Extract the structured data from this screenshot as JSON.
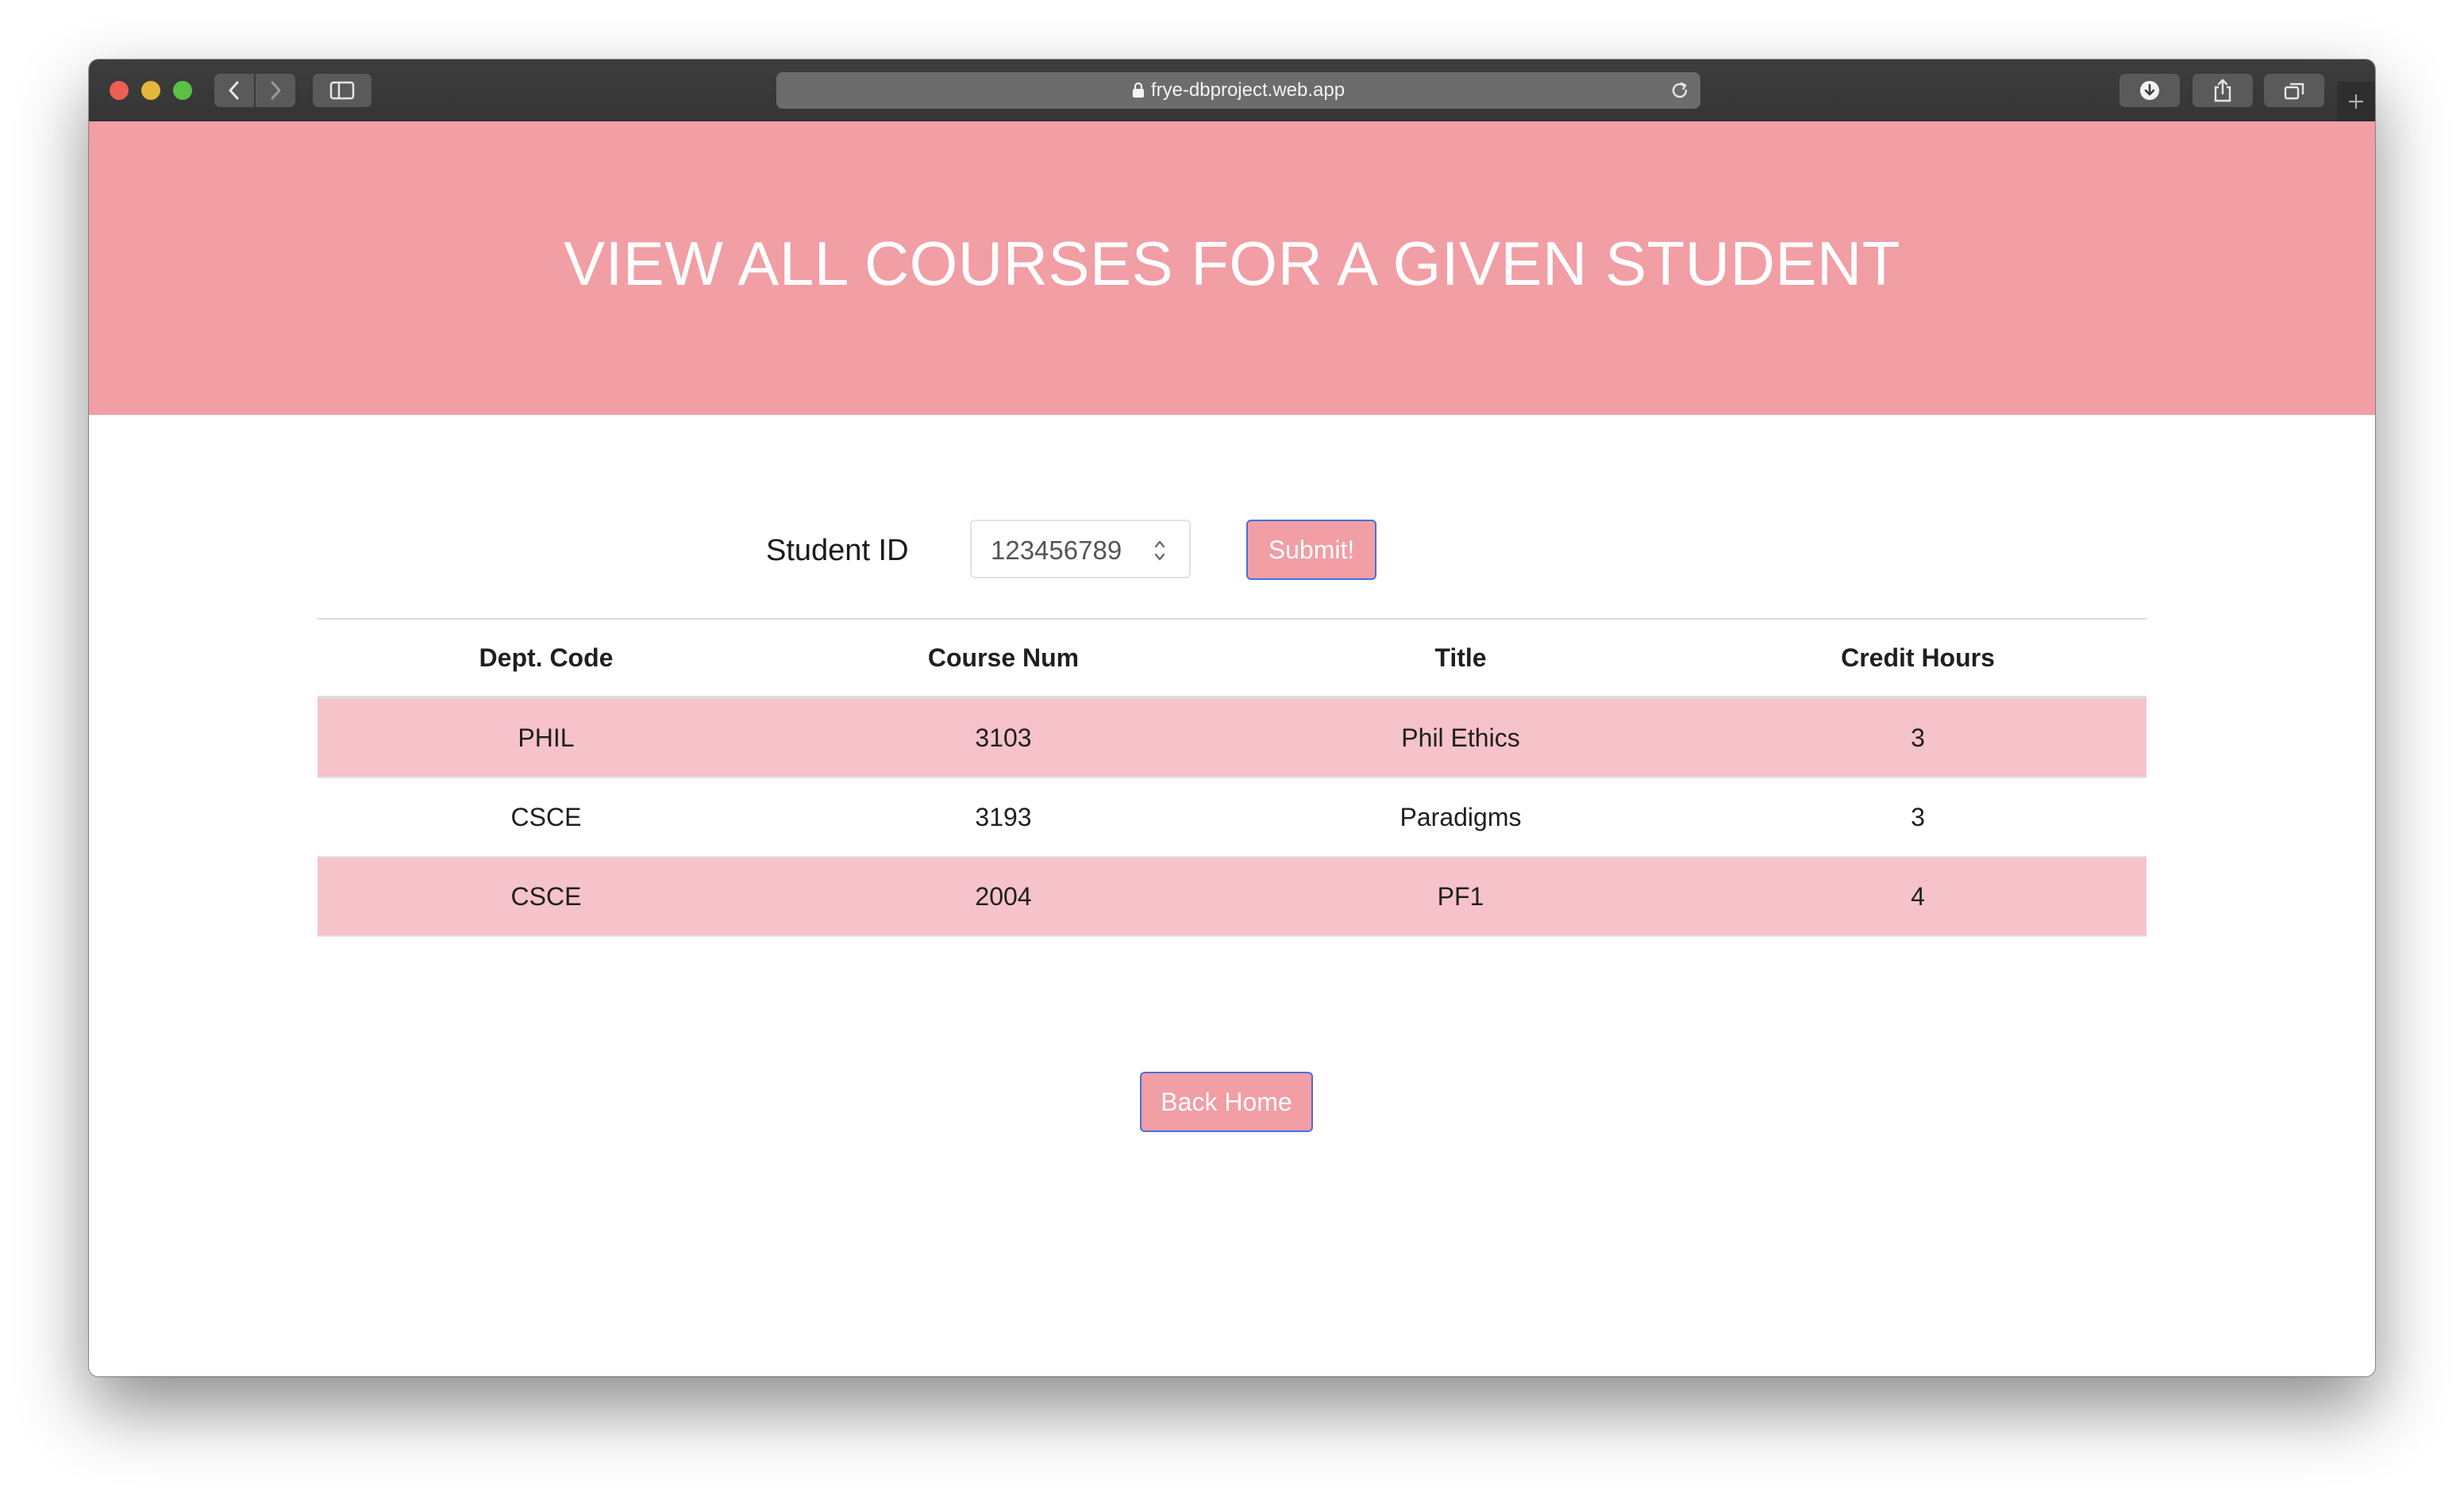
{
  "browser": {
    "url": "frye-dbproject.web.app",
    "icons": {
      "back": "chevron-left-icon",
      "forward": "chevron-right-icon",
      "sidebar": "sidebar-icon",
      "lock": "lock-icon",
      "reload": "reload-icon",
      "downloads": "download-icon",
      "share": "share-icon",
      "tabs": "tabs-overview-icon",
      "new_tab": "plus-icon"
    }
  },
  "page": {
    "banner_title": "VIEW ALL COURSES FOR A GIVEN STUDENT",
    "banner_color": "#f19ea5"
  },
  "form": {
    "label": "Student ID",
    "student_id_value": "123456789",
    "submit_label": "Submit!"
  },
  "table": {
    "headers": [
      "Dept. Code",
      "Course Num",
      "Title",
      "Credit Hours"
    ],
    "rows": [
      [
        "PHIL",
        "3103",
        "Phil Ethics",
        "3"
      ],
      [
        "CSCE",
        "3193",
        "Paradigms",
        "3"
      ],
      [
        "CSCE",
        "2004",
        "PF1",
        "4"
      ]
    ],
    "stripe_color": "#f5c3c9"
  },
  "footer": {
    "back_home_label": "Back Home"
  }
}
